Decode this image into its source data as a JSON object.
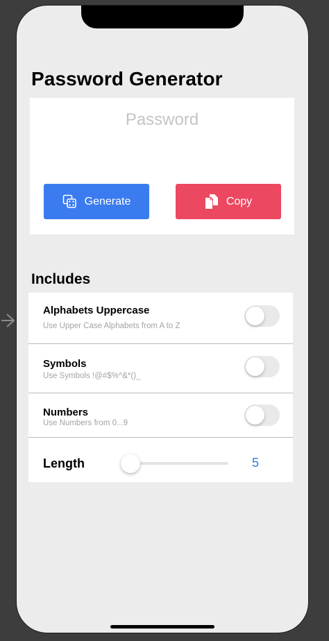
{
  "title": "Password Generator",
  "password": {
    "placeholder": "Password",
    "value": ""
  },
  "buttons": {
    "generate": {
      "label": "Generate",
      "icon": "dice-icon",
      "color": "#3a7bef"
    },
    "copy": {
      "label": "Copy",
      "icon": "copy-documents-icon",
      "color": "#ec4861"
    }
  },
  "includes": {
    "heading": "Includes",
    "options": [
      {
        "title": "Alphabets Uppercase",
        "subtitle": "Use Upper Case Alphabets from A to Z",
        "enabled": false
      },
      {
        "title": "Symbols",
        "subtitle": "Use Symbols !@#$%^&*()_",
        "enabled": false
      },
      {
        "title": "Numbers",
        "subtitle": "Use Numbers from 0...9",
        "enabled": false
      }
    ],
    "length": {
      "label": "Length",
      "value": "5",
      "slider_fraction": 0
    }
  },
  "colors": {
    "background": "#ececec",
    "accent_blue": "#3a7bef",
    "accent_red": "#ec4861",
    "value_blue": "#2f7be5"
  }
}
